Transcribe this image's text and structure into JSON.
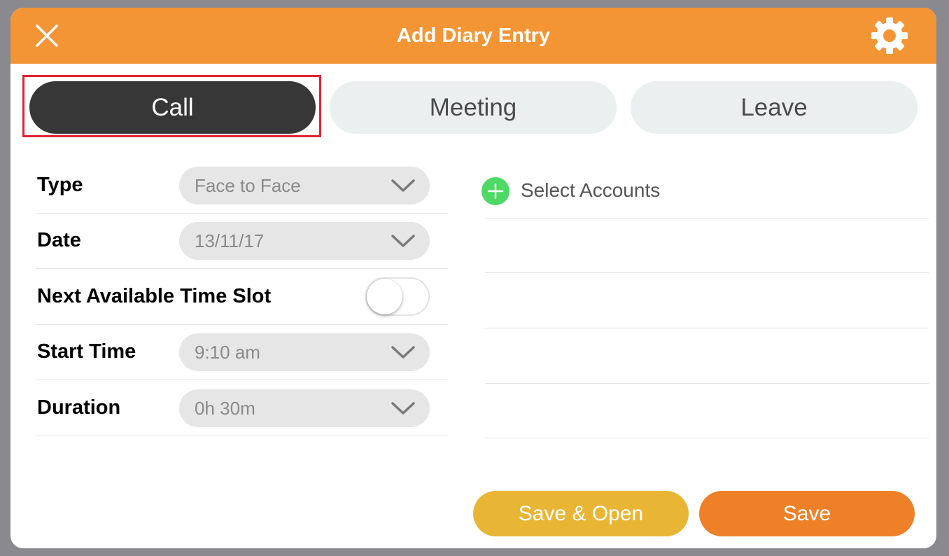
{
  "header": {
    "title": "Add Diary Entry",
    "close_icon": "close-icon",
    "settings_icon": "gear-icon",
    "background": "#f49535"
  },
  "tabs": [
    {
      "label": "Call",
      "active": true
    },
    {
      "label": "Meeting",
      "active": false
    },
    {
      "label": "Leave",
      "active": false
    }
  ],
  "form": {
    "type": {
      "label": "Type",
      "value": "Face to Face"
    },
    "date": {
      "label": "Date",
      "value": "13/11/17"
    },
    "next_slot": {
      "label": "Next Available Time Slot",
      "on": false
    },
    "start_time": {
      "label": "Start Time",
      "value": "9:10 am"
    },
    "duration": {
      "label": "Duration",
      "value": "0h 30m"
    }
  },
  "accounts": {
    "label": "Select Accounts",
    "icon": "plus-circle-icon",
    "icon_color": "#4cd964"
  },
  "buttons": {
    "save_open": "Save & Open",
    "save": "Save"
  },
  "colors": {
    "accent": "#f49535",
    "active_tab": "#373737",
    "save_open": "#e9b534",
    "save": "#ee8128",
    "highlight": "#e02535"
  }
}
